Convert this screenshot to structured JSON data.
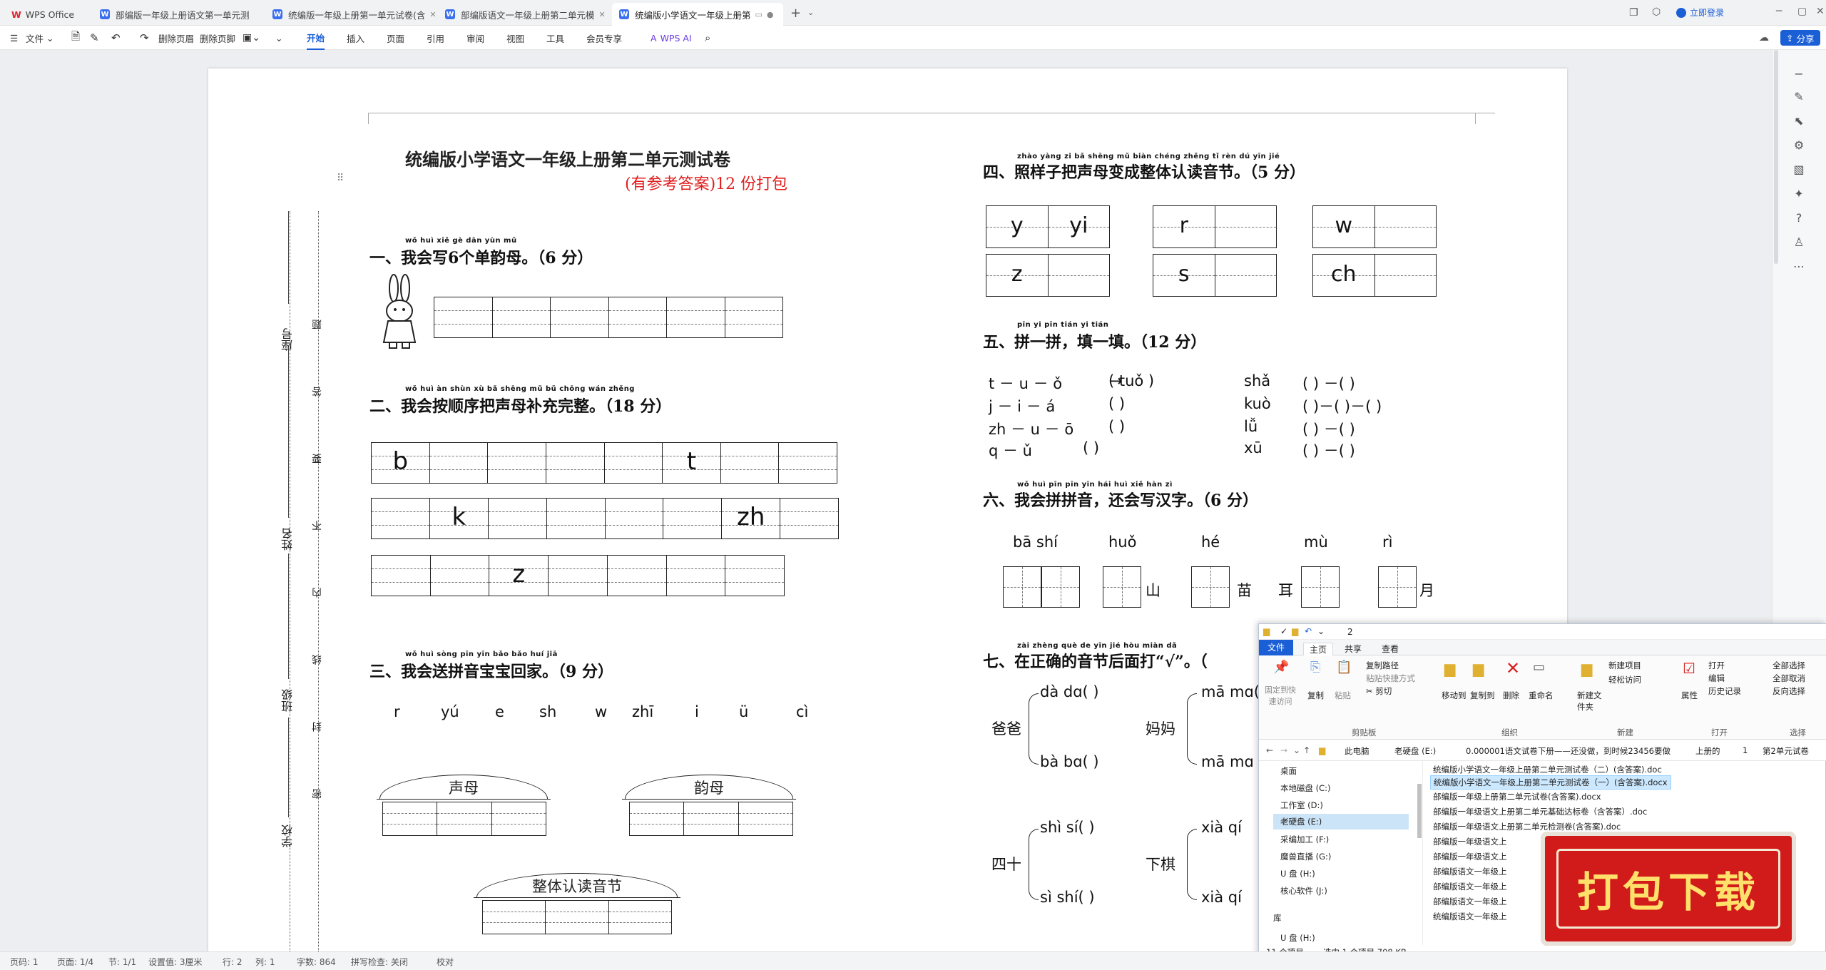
{
  "tabs": [
    {
      "label": "WPS Office",
      "icon": "wps-logo-icon"
    },
    {
      "label": "部编版一年级上册语文第一单元测",
      "icon": "word-doc-icon"
    },
    {
      "label": "统编版一年级上册第一单元试卷(含",
      "icon": "word-doc-icon"
    },
    {
      "label": "部编版语文一年级上册第二单元模",
      "icon": "word-doc-icon"
    },
    {
      "label": "统编版小学语文一年级上册第",
      "icon": "word-doc-icon"
    }
  ],
  "login_label": "立即登录",
  "share_label": "分享",
  "ribbon": {
    "file": "文件",
    "delete_header": "删除页眉",
    "delete_footer": "删除页脚",
    "tabs": [
      "开始",
      "插入",
      "页面",
      "引用",
      "审阅",
      "视图",
      "工具",
      "会员专享"
    ],
    "wps_ai": "WPS AI"
  },
  "doc": {
    "title": "统编版小学语文一年级上册第二单元测试卷",
    "subtitle": "(有参考答案)12 份打包",
    "side_labels": {
      "seat": "座号",
      "name": "姓名",
      "class": "班级",
      "school": "学校"
    },
    "side_dots": [
      "题",
      "答",
      "要",
      "不",
      "内",
      "线",
      "封",
      "密"
    ],
    "s1": {
      "pinyin": "wǒ huì xiě  gè dān yùn mǔ",
      "title": "一、我会写6个单韵母。（6 分）"
    },
    "s2": {
      "pinyin": "wǒ huì àn shùn xù bǎ shēng mǔ bǔ chōng wán zhěng",
      "title": "二、我会按顺序把声母补充完整。（18 分）",
      "row1": [
        "b",
        "",
        "",
        "",
        "",
        "t",
        "",
        ""
      ],
      "row2": [
        "",
        "k",
        "",
        "",
        "",
        "",
        "zh",
        ""
      ],
      "row3": [
        "",
        "",
        "z",
        "",
        "",
        "",
        "",
        ""
      ]
    },
    "s3": {
      "pinyin": "wǒ huì sòng pīn yīn bǎo bǎo huí jiā",
      "title": "三、我会送拼音宝宝回家。（9 分）",
      "items": [
        "r",
        "yú",
        "e",
        "sh",
        "w",
        "zhī",
        "i",
        "ü",
        "cì"
      ],
      "house1": "声母",
      "house2": "韵母",
      "house3": "整体认读音节"
    },
    "s4": {
      "pinyin": "zhào yàng zi bǎ shēng mǔ biàn chéng zhěng tǐ rèn dú yīn jié",
      "title": "四、照样子把声母变成整体认读音节。（5 分）",
      "pairs": [
        [
          "y",
          "yi"
        ],
        [
          "r",
          ""
        ],
        [
          "w",
          ""
        ],
        [
          "z",
          ""
        ],
        [
          "s",
          ""
        ],
        [
          "ch",
          ""
        ]
      ]
    },
    "s5": {
      "pinyin": "pīn yi pīn    tián yi tián",
      "title": "五、拼一拼，填一填。（12 分）",
      "left": [
        "t  －  u  －  ǒ",
        "j  －  i  －  á",
        "zh  －  u  －  ō",
        "q  －  ǔ"
      ],
      "left_ans": [
        "( tuǒ )",
        "(      )",
        "(      )",
        "(      )"
      ],
      "right": [
        "shǎ",
        "kuò",
        "lǚ",
        "xū"
      ],
      "right_ans": [
        "(    )  －(    )",
        "(    )－(    )－(    )",
        "(    )  －(    )",
        "(    )  －(    )"
      ]
    },
    "s6": {
      "pinyin": "wǒ huì pīn pīn yīn    hái huì xiě hàn zì",
      "title": "六、我会拼拼音，还会写汉字。（6 分）",
      "pys": [
        "bā  shí",
        "huǒ",
        "hé",
        "mù",
        "rì"
      ],
      "chars": [
        "山",
        "苗",
        "耳",
        "月"
      ]
    },
    "s7": {
      "pinyin": "zài zhèng què de yīn jié hòu miàn dǎ",
      "title": "七、在正确的音节后面打“√”。（",
      "w1": "爸爸",
      "w1a": "dà  dɑ(   )",
      "w1b": "bà  bɑ(   )",
      "w2": "妈妈",
      "w2a": "mā  mɑ(",
      "w2b": "mā  mɑ",
      "w3": "四十",
      "w3a": "shì  sí(   )",
      "w3b": "sì  shí(   )",
      "w4": "下棋",
      "w4a": "xià  qí",
      "w4b": "xià  qí"
    }
  },
  "explorer": {
    "title": "2",
    "tabs": [
      "文件",
      "主页",
      "共享",
      "查看"
    ],
    "pin_label": "固定到快速访问",
    "copy": "复制",
    "paste": "粘贴",
    "copy_path": "复制路径",
    "paste_shortcut": "粘贴快捷方式",
    "cut": "剪切",
    "move_to": "移动到",
    "copy_to": "复制到",
    "delete": "删除",
    "rename": "重命名",
    "new_folder": "新建文件夹",
    "new_item": "新建项目",
    "easy_access": "轻松访问",
    "properties": "属性",
    "open": "打开",
    "edit": "编辑",
    "history": "历史记录",
    "select_all": "全部选择",
    "select_none": "全部取消",
    "invert": "反向选择",
    "groups": [
      "剪贴板",
      "组织",
      "新建",
      "打开",
      "选择"
    ],
    "path": [
      "此电脑",
      "老硬盘 (E:)",
      "0.000001语文试卷下册——还没做，到时候23456要做",
      "上册的",
      "1",
      "第2单元试卷"
    ],
    "nav": [
      "桌面",
      "本地磁盘 (C:)",
      "工作室 (D:)",
      "老硬盘 (E:)",
      "采编加工 (F:)",
      "魔兽直播 (G:)",
      "U 盘 (H:)",
      "核心软件 (J:)",
      "库",
      "U 盘 (H:)"
    ],
    "files": [
      "统编版小学语文一年级上册第二单元测试卷（二）(含答案).doc",
      "统编版小学语文一年级上册第二单元测试卷（一）(含答案).docx",
      "部编版一年级上册第二单元试卷(含答案).docx",
      "部编版一年级语文上册第二单元基础达标卷（含答案）.doc",
      "部编版一年级语文上册第二单元检测卷(含答案).doc",
      "部编版一年级语文上",
      "部编版一年级语文上",
      "部编版语文一年级上",
      "部编版语文一年级上",
      "部编版语文一年级上",
      "统编版语文一年级上"
    ],
    "status_count": "11 个项目",
    "status_sel": "选中 1 个项目  708 KB"
  },
  "stamp_text": "打包下载",
  "status": {
    "page_no": "页码: 1",
    "pages": "页面: 1/4",
    "section": "节: 1/1",
    "setting": "设置值: 3厘米",
    "row": "行: 2",
    "col": "列: 1",
    "words": "字数: 864",
    "spell": "拼写检查: 关闭",
    "proof": "校对"
  }
}
